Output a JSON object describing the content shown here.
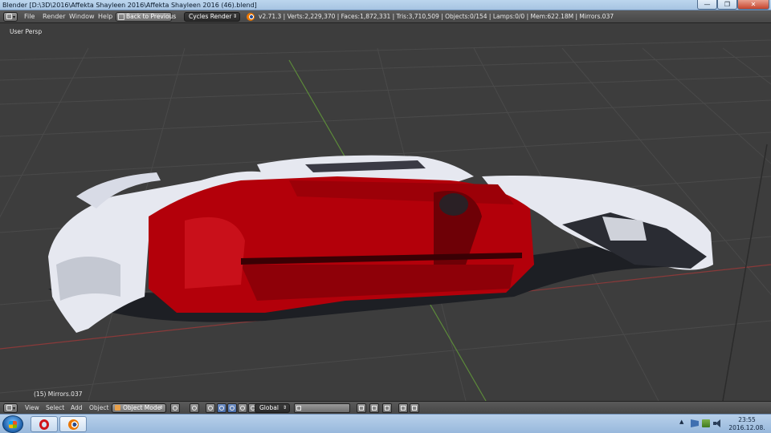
{
  "window": {
    "title": "Blender [D:\\3D\\2016\\Affekta Shayleen 2016\\Affekta Shayleen 2016 (46).blend]",
    "minimize_glyph": "—",
    "maximize_glyph": "❐",
    "close_glyph": "✕"
  },
  "info_header": {
    "menus": [
      "File",
      "Render",
      "Window",
      "Help"
    ],
    "back_button": "Back to Previous",
    "render_engine": "Cycles Render",
    "stats": "v2.71.3 | Verts:2,229,370 | Faces:1,872,331 | Tris:3,710,509 | Objects:0/154 | Lamps:0/0 | Mem:622.18M | Mirrors.037"
  },
  "viewport": {
    "view_label": "User Persp",
    "object_label": "(15) Mirrors.037",
    "colors": {
      "background": "#3d3d3d",
      "grid": "#4a4a4a",
      "x_axis": "#8a3a3a",
      "y_axis": "#5c8a3a",
      "car_red": "#b3000a",
      "car_white": "#e6e8f0"
    }
  },
  "view_header": {
    "menus": [
      "View",
      "Select",
      "Add",
      "Object"
    ],
    "mode": "Object Mode",
    "orientation": "Global",
    "icons": [
      "viewport-shading-icon",
      "pivot-icon",
      "manipulator-icon",
      "translate-icon",
      "rotate-icon",
      "scale-icon",
      "layers-icon",
      "lock-icon",
      "snap-icon",
      "render-preview-icon"
    ]
  },
  "taskbar": {
    "apps": [
      "opera-icon",
      "blender-icon"
    ],
    "time": "23:55",
    "date": "2016.12.08."
  }
}
